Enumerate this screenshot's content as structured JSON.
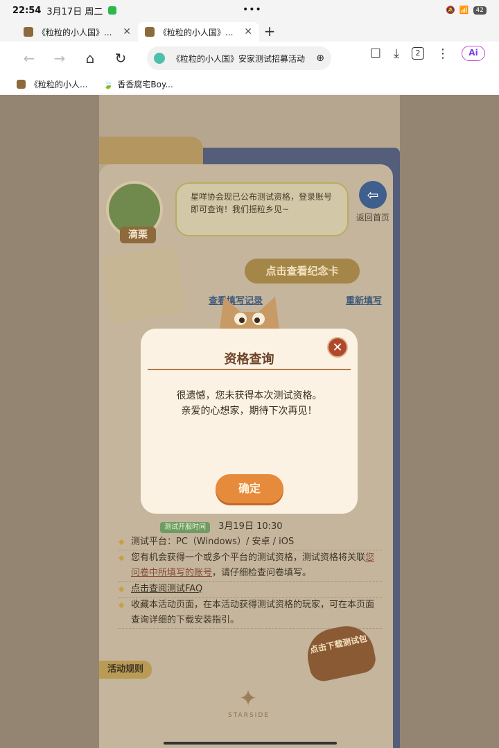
{
  "status_bar": {
    "time": "22:54",
    "date": "3月17日 周二",
    "battery": "42"
  },
  "tabs": [
    {
      "title": "《粒粒的小人国》...",
      "active": false
    },
    {
      "title": "《粒粒的小人国》...",
      "active": true
    }
  ],
  "address_bar": {
    "url": "《粒粒的小人国》安家测试招募活动",
    "tab_count": "2",
    "ai_label": "Ai"
  },
  "bookmarks": [
    {
      "label": "《粒粒的小人...",
      "icon": "app-favicon"
    },
    {
      "label": "香香腐宅Boy...",
      "icon": "leaf-icon"
    }
  ],
  "page": {
    "character_name": "滴栗",
    "bubble_text": "星咩协会现已公布测试资格，登录账号即可查询！我们摇粒乡见~",
    "back_home": "返回首页",
    "card_button": "点击查看纪念卡",
    "view_record": "查看填写记录",
    "refill": "重新填写",
    "open_time_pill": "测试开服时间",
    "open_time": "3月19日 10:30",
    "platform_line": "测试平台：PC（Windows）/ 安卓 / iOS",
    "qual_line_1": "您有机会获得一个或多个平台的测试资格，测试资格将关联",
    "qual_line_hl": "您问卷中所填写的账号",
    "qual_line_2": "，请仔细检查问卷填写。",
    "faq_link": "点击查阅测试FAQ",
    "bookmark_line": "收藏本活动页面，在本活动获得测试资格的玩家，可在本页面查询详细的下载安装指引。",
    "download_badge": "点击下载测试包",
    "rules_tab": "活动规则",
    "logo_text": "STARSIDE"
  },
  "dialog": {
    "title": "资格查询",
    "line1": "很遗憾，您未获得本次测试资格。",
    "line2": "亲爱的心想家，期待下次再见！",
    "ok_label": "确定",
    "close_symbol": "✕"
  },
  "colors": {
    "dialog_bg": "#fbf2e3",
    "ok_button": "#e68a3c",
    "close_button": "#b0492c",
    "overlay_tone": "#9b8c7a"
  }
}
